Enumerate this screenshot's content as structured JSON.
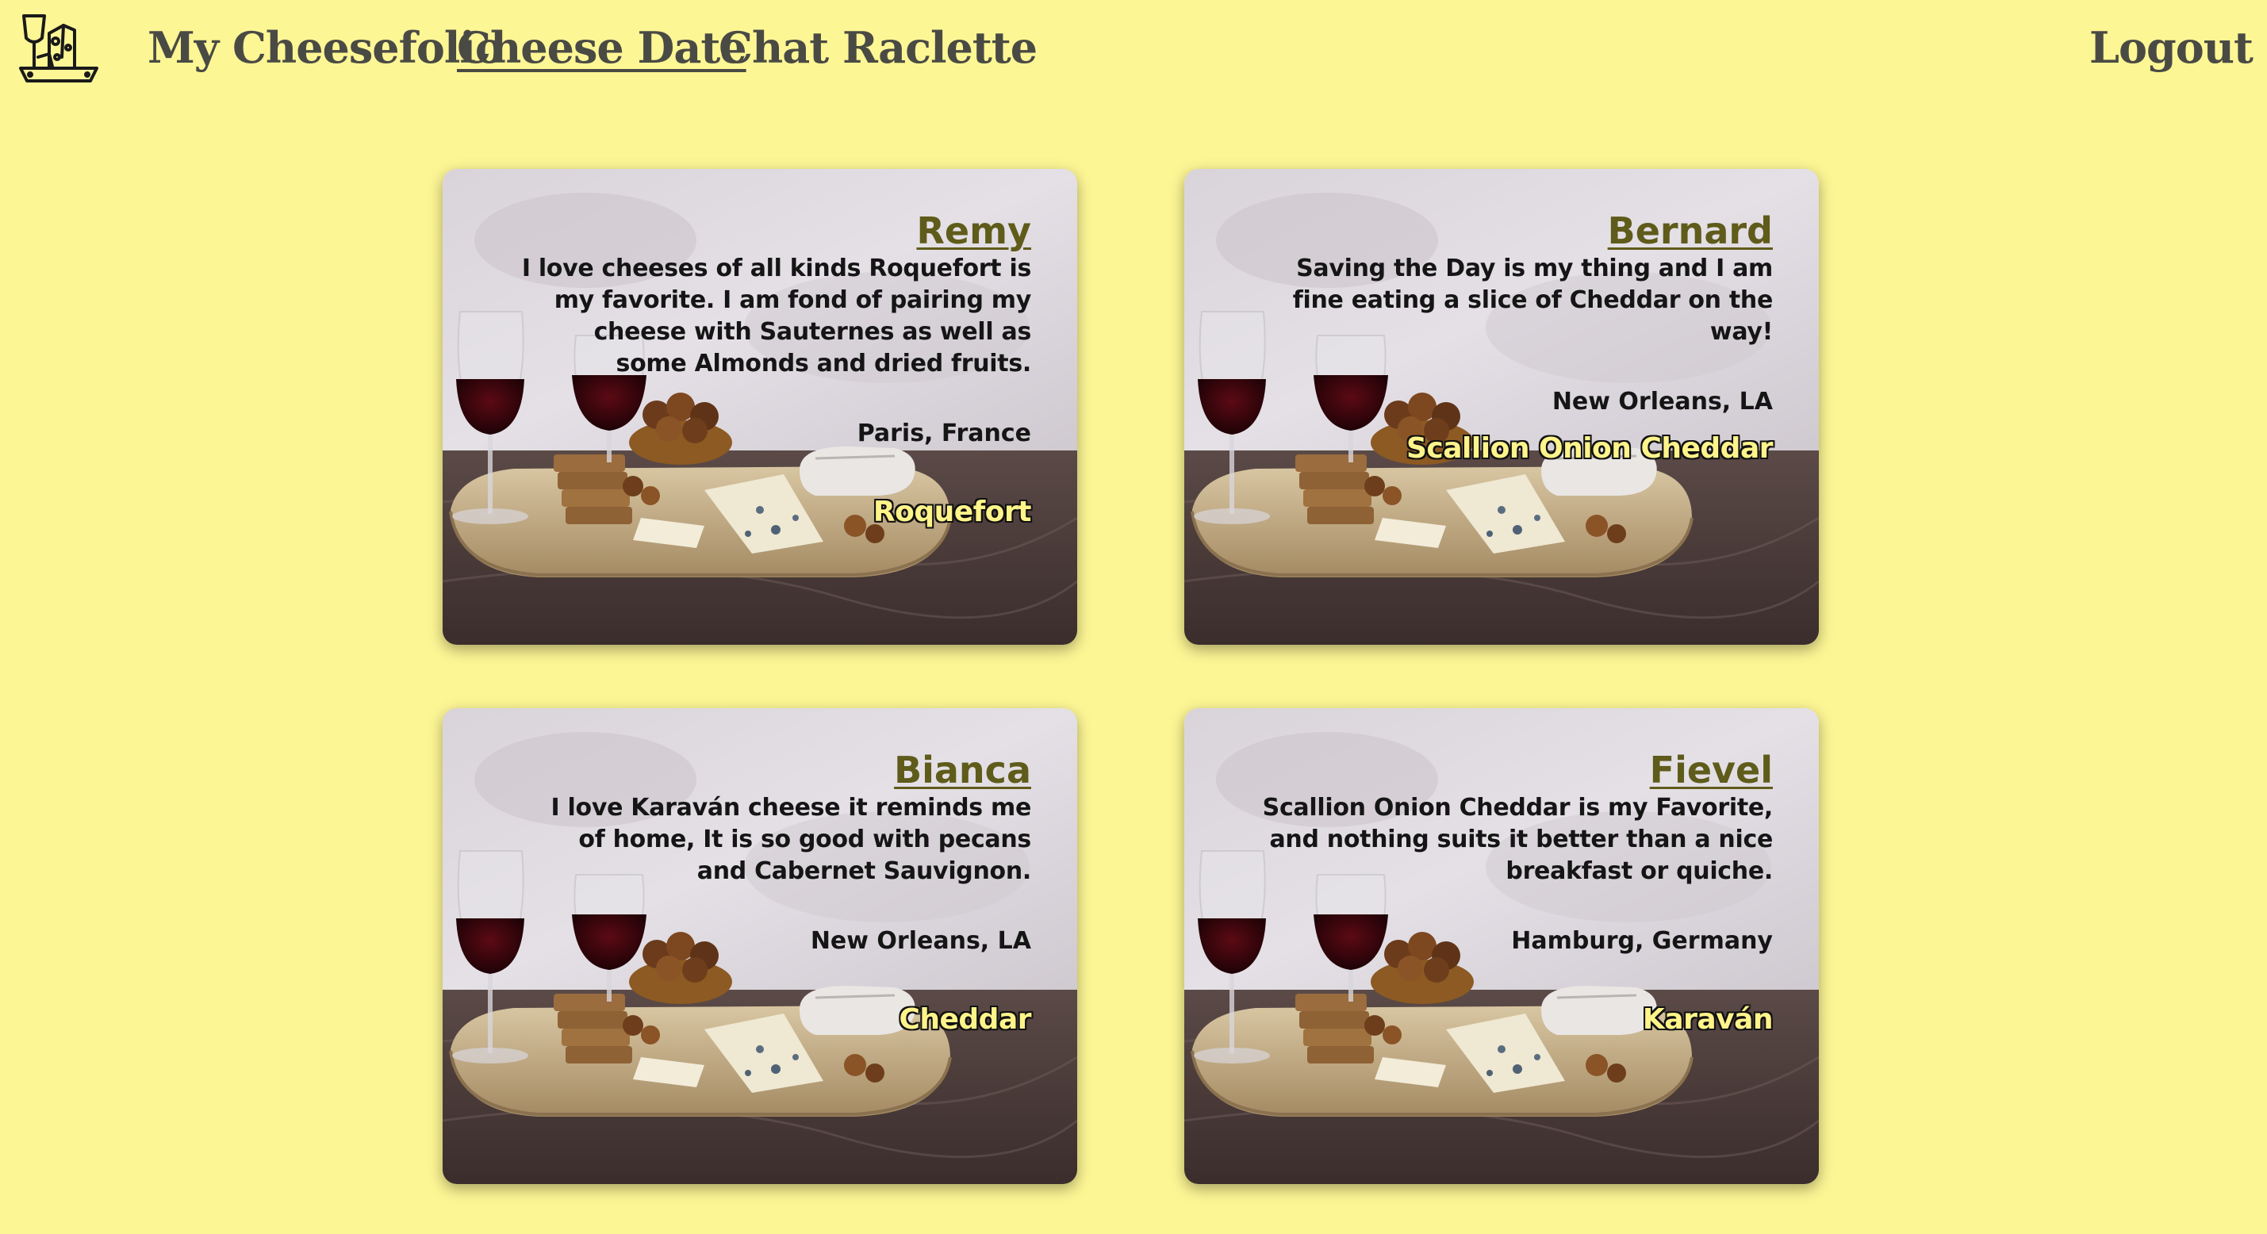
{
  "nav": {
    "logo_icon": "cheese-board-wine-icon",
    "links": [
      "My Cheesefolio",
      "Cheese Date",
      "Chat Raclette"
    ],
    "active": "Cheese Date",
    "logout": "Logout"
  },
  "colors": {
    "background": "#fdf695",
    "nav_text": "#4a4a44",
    "card_name": "#5f5b1a",
    "cheese_tag": "#fff48a"
  },
  "cards": [
    {
      "name": "Remy",
      "bio": "I love cheeses of all kinds Roquefort is my favorite. I am fond of pairing my cheese with Sauternes as well as some Almonds and dried fruits.",
      "location": "Paris, France",
      "cheese": "Roquefort"
    },
    {
      "name": "Bernard",
      "bio": "Saving the Day is my thing and I am fine eating a slice of Cheddar on the way!",
      "location": "New Orleans, LA",
      "cheese": "Scallion Onion Cheddar"
    },
    {
      "name": "Bianca",
      "bio": "I love Karaván cheese it reminds me of home, It is so good with pecans and Cabernet Sauvignon.",
      "location": "New Orleans, LA",
      "cheese": "Cheddar"
    },
    {
      "name": "Fievel",
      "bio": "Scallion Onion Cheddar is my Favorite, and nothing suits it better than a nice breakfast or quiche.",
      "location": "Hamburg, Germany",
      "cheese": "Karaván"
    }
  ]
}
